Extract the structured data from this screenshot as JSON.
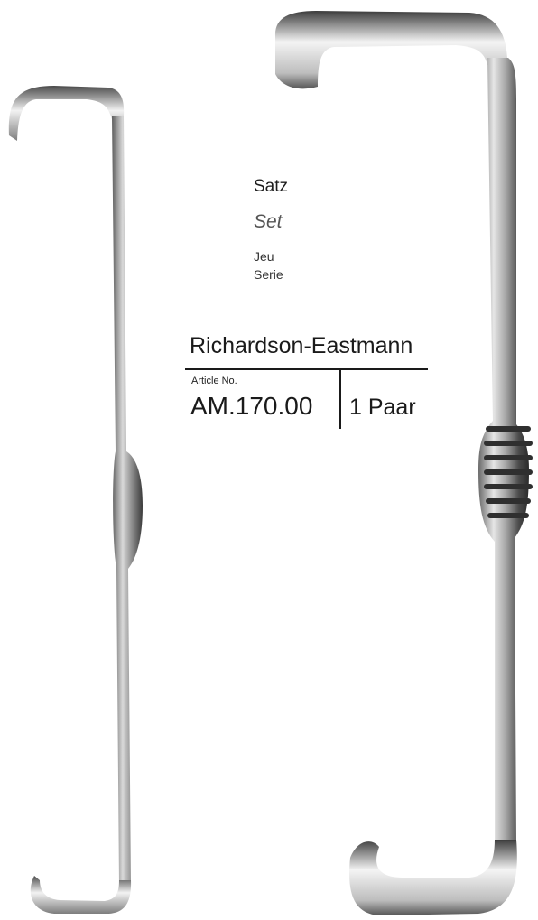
{
  "product": {
    "set_de": "Satz",
    "set_en": "Set",
    "set_fr": "Jeu",
    "set_it": "Serie",
    "name": "Richardson-Eastmann",
    "article_label": "Article No.",
    "article_number": "AM.170.00",
    "quantity": "1 Paar"
  }
}
